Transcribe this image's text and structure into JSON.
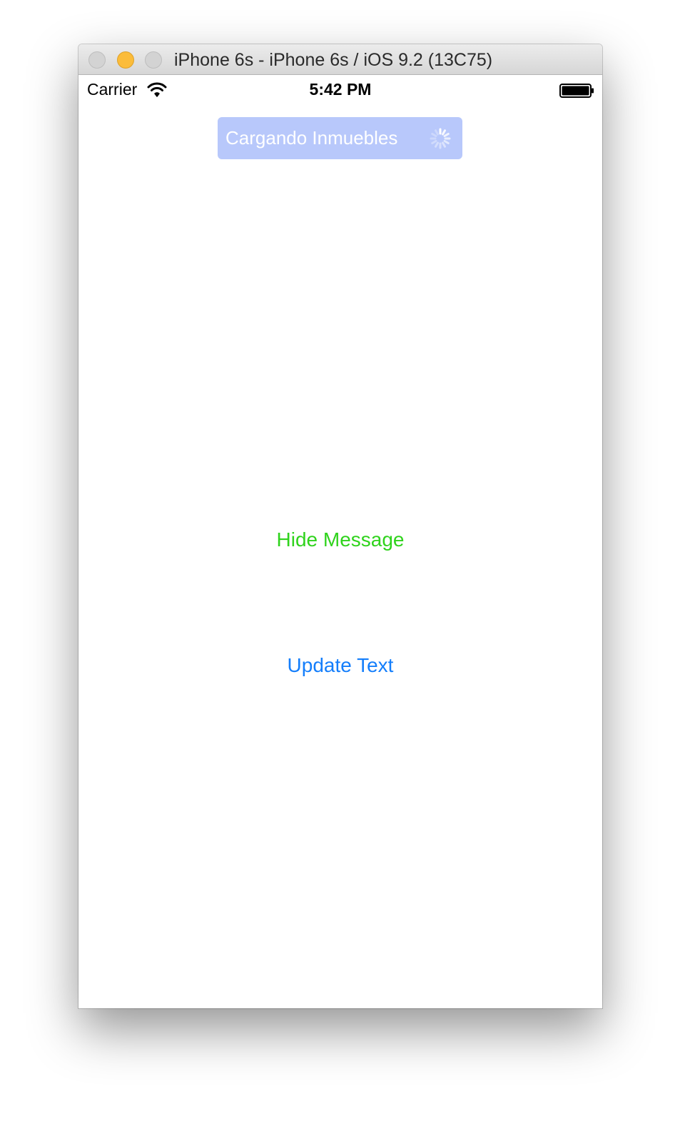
{
  "window": {
    "title": "iPhone 6s - iPhone 6s / iOS 9.2 (13C75)"
  },
  "status_bar": {
    "carrier": "Carrier",
    "time": "5:42 PM",
    "icons": [
      "wifi-icon",
      "battery-icon"
    ]
  },
  "banner": {
    "text": "Cargando Inmuebles",
    "icon": "spinner-icon",
    "background_color": "#b8c8fb"
  },
  "buttons": {
    "hide_message": {
      "label": "Hide Message",
      "color": "#2fd31c"
    },
    "update_text": {
      "label": "Update Text",
      "color": "#147efb"
    }
  },
  "colors": {
    "minimize_button": "#fbbc3a",
    "inactive_traffic_light": "#d3d3d3"
  }
}
